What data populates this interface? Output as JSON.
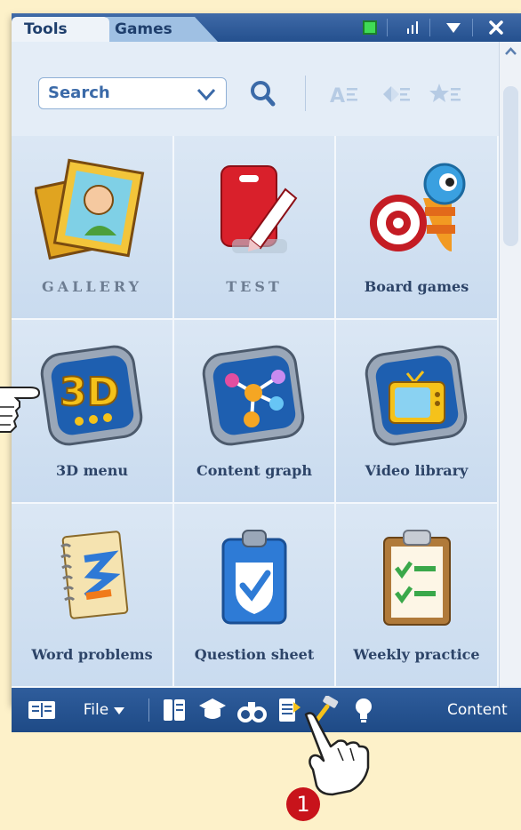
{
  "titlebar": {
    "tabs": [
      {
        "label": "Tools",
        "active": true
      },
      {
        "label": "Games",
        "active": false
      }
    ],
    "icons": [
      "green-square-icon",
      "signal-bars-icon",
      "dropdown-triangle-icon",
      "close-icon"
    ]
  },
  "search": {
    "placeholder": "Search"
  },
  "toolbar_icons": [
    "search-icon",
    "sort-alpha-icon",
    "sort-direction-icon",
    "favorites-icon"
  ],
  "grid": {
    "items": [
      {
        "label": "GALLERY",
        "icon": "gallery-frame-icon"
      },
      {
        "label": "TEST",
        "icon": "test-pencil-icon"
      },
      {
        "label": "Board games",
        "icon": "board-games-target-icon"
      },
      {
        "label": "3D menu",
        "icon": "3d-menu-icon"
      },
      {
        "label": "Content graph",
        "icon": "content-graph-icon"
      },
      {
        "label": "Video library",
        "icon": "video-library-tv-icon"
      },
      {
        "label": "Word problems",
        "icon": "word-problems-notebook-icon"
      },
      {
        "label": "Question sheet",
        "icon": "question-sheet-clipboard-icon"
      },
      {
        "label": "Weekly practice",
        "icon": "weekly-practice-checklist-icon"
      }
    ]
  },
  "bottombar": {
    "file_label": "File",
    "content_label": "Content",
    "icons": [
      "book-icon",
      "pages-icon",
      "graduation-cap-icon",
      "binoculars-icon",
      "document-icon",
      "hammer-icon",
      "lightbulb-icon"
    ]
  },
  "callout": {
    "number": "1"
  },
  "colors": {
    "titlebar": "#2a5594",
    "panel": "#e4edf7",
    "badge": "#c8131b",
    "background": "#fdf1c9"
  }
}
